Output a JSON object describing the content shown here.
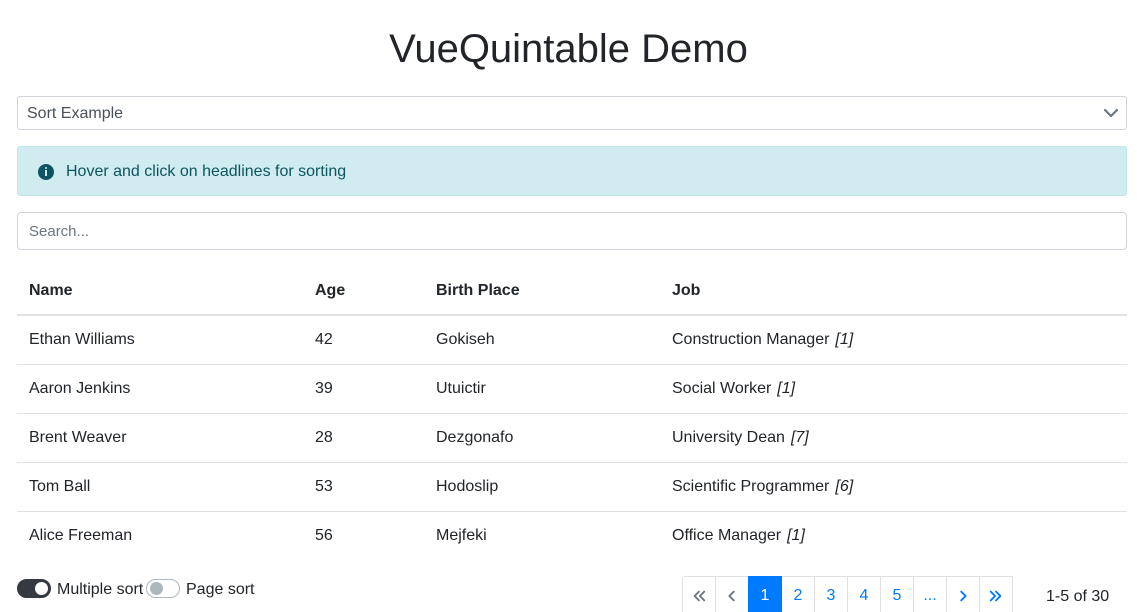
{
  "header": {
    "title": "VueQuintable Demo"
  },
  "example_select": {
    "value": "Sort Example"
  },
  "alert": {
    "text": "Hover and click on headlines for sorting"
  },
  "search": {
    "placeholder": "Search..."
  },
  "table": {
    "columns": [
      "Name",
      "Age",
      "Birth Place",
      "Job"
    ],
    "rows": [
      {
        "name": "Ethan Williams",
        "age": "42",
        "birth_place": "Gokiseh",
        "job": "Construction Manager",
        "ref": "[1]"
      },
      {
        "name": "Aaron Jenkins",
        "age": "39",
        "birth_place": "Utuictir",
        "job": "Social Worker",
        "ref": "[1]"
      },
      {
        "name": "Brent Weaver",
        "age": "28",
        "birth_place": "Dezgonafo",
        "job": "University Dean",
        "ref": "[7]"
      },
      {
        "name": "Tom Ball",
        "age": "53",
        "birth_place": "Hodoslip",
        "job": "Scientific Programmer",
        "ref": "[6]"
      },
      {
        "name": "Alice Freeman",
        "age": "56",
        "birth_place": "Mejfeki",
        "job": "Office Manager",
        "ref": "[1]"
      }
    ]
  },
  "toggles": {
    "multiple_sort": {
      "label": "Multiple sort",
      "on": true
    },
    "page_sort": {
      "label": "Page sort",
      "on": false
    }
  },
  "pagination": {
    "pages": [
      "1",
      "2",
      "3",
      "4",
      "5",
      "..."
    ],
    "active": "1",
    "status": "1-5 of 30"
  },
  "colors": {
    "primary": "#007bff",
    "alert_bg": "#d1ecf1",
    "alert_text": "#0c5460",
    "toggle_on": "#343a40"
  },
  "icons": {
    "select": "chevron-down-icon",
    "alert": "info-circle-icon",
    "first": "double-chevron-left-icon",
    "prev": "chevron-left-icon",
    "next": "chevron-right-icon",
    "last": "double-chevron-right-icon"
  }
}
